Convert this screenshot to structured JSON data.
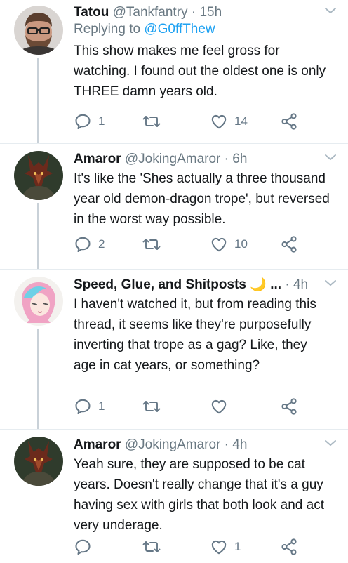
{
  "tweets": [
    {
      "name": "Tatou",
      "handle": "@Tankfantry",
      "dot": " · ",
      "time": "15h",
      "replying_prefix": "Replying to ",
      "replying_to": "@G0ffThew",
      "text": "This show makes me feel gross for watching. I found out the oldest one is only THREE damn years old.",
      "replies": "1",
      "retweets": "",
      "likes": "14",
      "avatar_icon": "bearded-man-glasses-avatar"
    },
    {
      "name": "Amaror",
      "handle": "@JokingAmaror",
      "dot": " · ",
      "time": "6h",
      "text": "It's like the 'Shes actually a three thousand year old demon-dragon trope', but reversed in the worst way possible.",
      "replies": "2",
      "retweets": "",
      "likes": "10",
      "avatar_icon": "dragon-avatar"
    },
    {
      "name": "Speed, Glue, and Shitposts",
      "emoji": "🌙",
      "ellipsis": "...",
      "dot": " · ",
      "time": "4h",
      "text": "I haven't watched it, but from reading this thread, it seems like they're purposefully inverting that trope as a gag? Like, they age in cat years, or something?",
      "replies": "1",
      "retweets": "",
      "likes": "",
      "avatar_icon": "anime-girl-avatar"
    },
    {
      "name": "Amaror",
      "handle": "@JokingAmaror",
      "dot": " · ",
      "time": "4h",
      "text": "Yeah sure, they are supposed to be cat years. Doesn't really change that it's a guy having sex with girls that both look and act very underage.",
      "replies": "",
      "retweets": "",
      "likes": "1",
      "avatar_icon": "dragon-avatar"
    }
  ],
  "colors": {
    "link": "#1da1f2",
    "secondary": "#697882",
    "icon": "#657786",
    "thread_line": "#c9d1d8",
    "divider": "#e6ecf0"
  },
  "icons": [
    "reply-icon",
    "retweet-icon",
    "like-icon",
    "share-icon",
    "chevron-down-icon"
  ]
}
